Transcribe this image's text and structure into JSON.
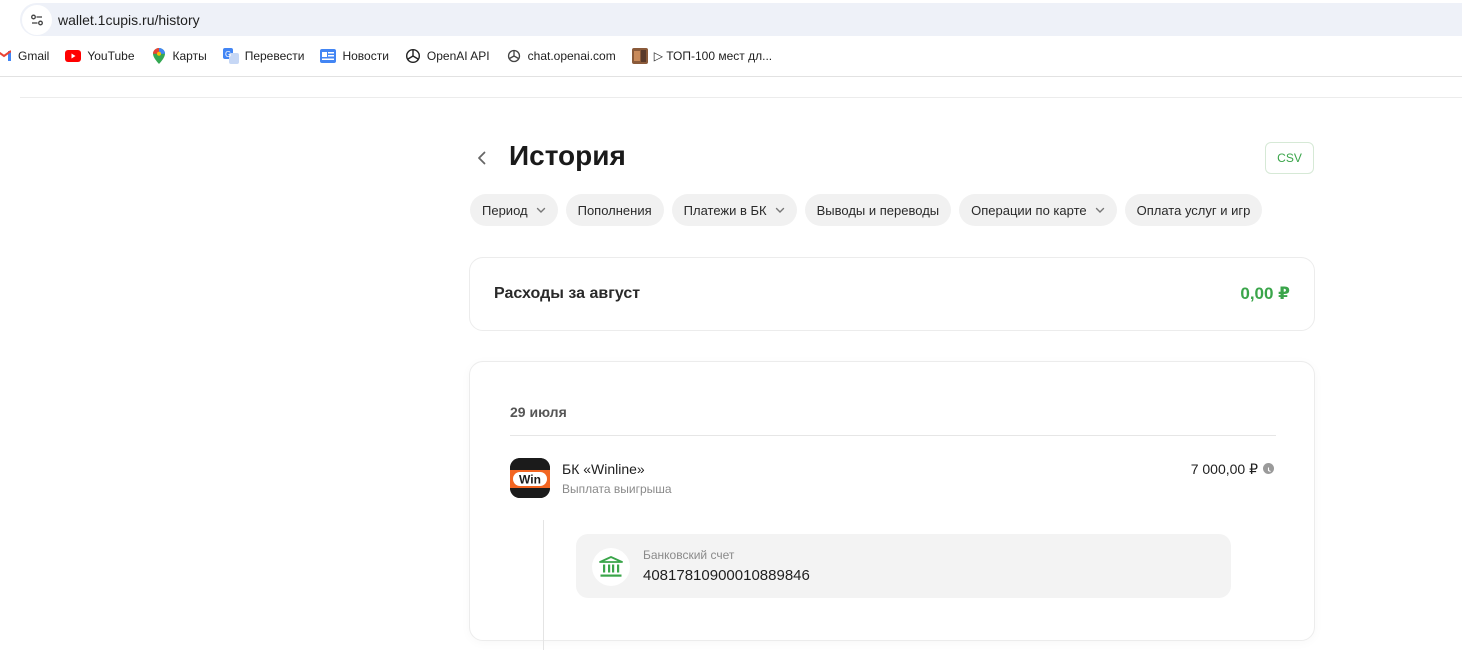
{
  "browser": {
    "url": "wallet.1cupis.ru/history",
    "bookmarks": [
      {
        "label": "Gmail",
        "icon": "gmail-icon"
      },
      {
        "label": "YouTube",
        "icon": "youtube-icon"
      },
      {
        "label": "Карты",
        "icon": "maps-icon"
      },
      {
        "label": "Перевести",
        "icon": "translate-icon"
      },
      {
        "label": "Новости",
        "icon": "news-icon"
      },
      {
        "label": "OpenAI API",
        "icon": "openai-icon"
      },
      {
        "label": "chat.openai.com",
        "icon": "chatgpt-icon"
      },
      {
        "label": "▷ ТОП-100 мест дл...",
        "icon": "image-thumb-icon"
      }
    ]
  },
  "page": {
    "title": "История",
    "csv_label": "CSV",
    "filters": [
      {
        "label": "Период",
        "dropdown": true
      },
      {
        "label": "Пополнения",
        "dropdown": false
      },
      {
        "label": "Платежи в БК",
        "dropdown": true
      },
      {
        "label": "Выводы и переводы",
        "dropdown": false
      },
      {
        "label": "Операции по карте",
        "dropdown": true
      },
      {
        "label": "Оплата услуг и игр",
        "dropdown": false
      }
    ],
    "summary": {
      "label": "Расходы за август",
      "amount": "0,00 ₽"
    },
    "history": {
      "date": "29 июля",
      "transaction": {
        "logo_text": "Win",
        "name": "БК «Winline»",
        "subtitle": "Выплата выигрыша",
        "amount": "7 000,00 ₽",
        "status_icon": "clock-icon"
      },
      "destination": {
        "label": "Банковский счет",
        "number": "40817810900010889846",
        "icon": "bank-icon"
      }
    }
  },
  "colors": {
    "accent_green": "#3aa54a",
    "chip_bg": "#f1f1f1",
    "urlbar_bg": "#eef1f8"
  }
}
